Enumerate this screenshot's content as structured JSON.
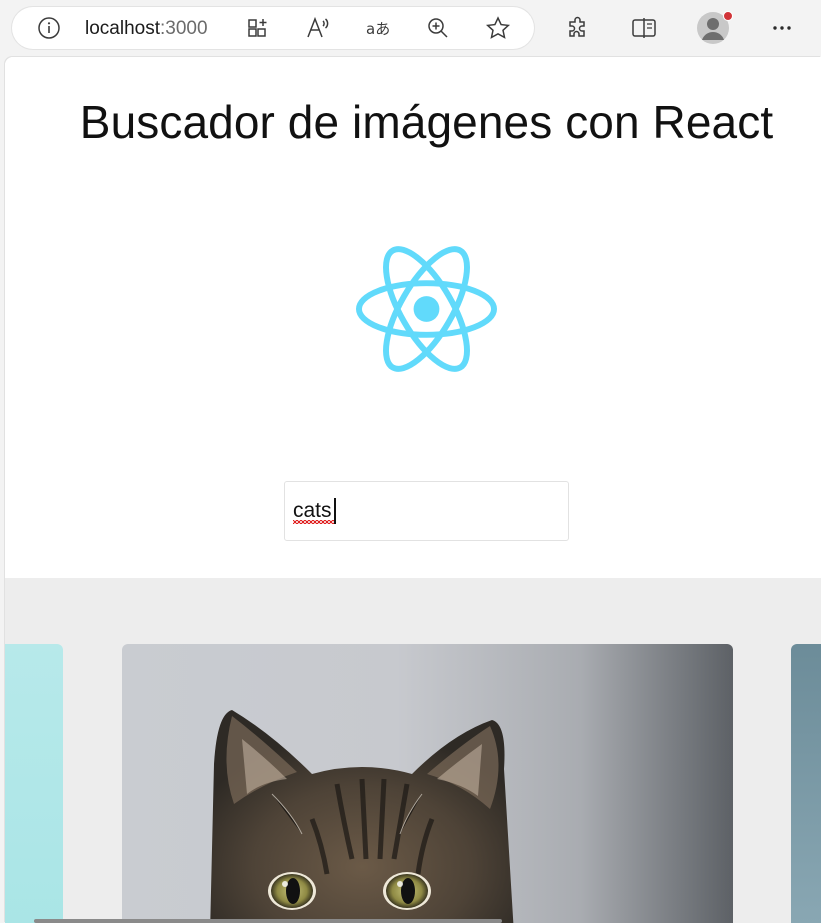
{
  "browser": {
    "url_host": "localhost",
    "url_port": ":3000",
    "icons": [
      "info-icon",
      "app-available-icon",
      "read-aloud-icon",
      "translate-icon",
      "zoom-icon",
      "favorite-star-icon",
      "extensions-icon",
      "split-screen-icon",
      "profile-avatar",
      "more-menu-icon"
    ]
  },
  "page": {
    "title": "Buscador de imágenes con React",
    "logo": "react-logo",
    "search": {
      "value": "cats",
      "placeholder": ""
    }
  },
  "gallery": {
    "images": [
      {
        "subject": "teal image (partially visible)"
      },
      {
        "subject": "tabby cat with green eyes"
      },
      {
        "subject": "blue-grey image (partially visible)"
      }
    ]
  },
  "colors": {
    "react_blue": "#61dafb",
    "gallery_bg": "#ededed",
    "chrome_bg": "#f3f3f3",
    "notification_dot": "#d13438"
  }
}
